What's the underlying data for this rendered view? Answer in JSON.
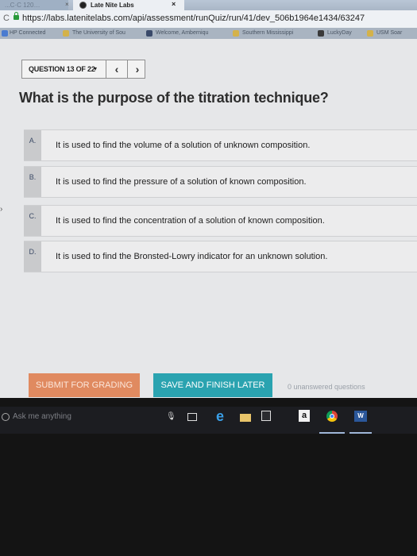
{
  "browser": {
    "tabs": [
      {
        "label": "...C·C 120…",
        "active": false
      },
      {
        "label": "Late Nite Labs",
        "active": true
      }
    ],
    "close_glyph": "×",
    "url": "https://labs.latenitelabs.com/api/assessment/runQuiz/run/41/dev_506b1964e1434/63247",
    "bookmarks": [
      {
        "label": "HP Connected",
        "icon": "hp-icon",
        "color": "#4a7bd0"
      },
      {
        "label": "The University of Sou",
        "icon": "university-icon",
        "color": "#d4b24a"
      },
      {
        "label": "Welcome, Amberniqu",
        "icon": "portal-icon",
        "color": "#3a4a6a"
      },
      {
        "label": "Southern Mississippi",
        "icon": "usm-icon",
        "color": "#d4b24a"
      },
      {
        "label": "LuckyDay",
        "icon": "luckyday-icon",
        "color": "#3a3a3a"
      },
      {
        "label": "USM Soar",
        "icon": "soar-icon",
        "color": "#d4b24a"
      }
    ]
  },
  "quiz": {
    "counter": "QUESTION 13 OF 22",
    "caret": "▾",
    "prev": "‹",
    "next": "›",
    "question": "What is the purpose of the titration technique?",
    "answers": [
      {
        "letter": "A.",
        "text": "It is used to find the volume of a solution of unknown composition."
      },
      {
        "letter": "B.",
        "text": "It is used to find the pressure of a solution of known composition."
      },
      {
        "letter": "C.",
        "text": "It is used to find the concentration of a solution of known composition."
      },
      {
        "letter": "D.",
        "text": "It is used to find the Bronsted-Lowry indicator for an unknown solution."
      }
    ],
    "submit_label": "SUBMIT FOR GRADING",
    "save_label": "SAVE AND FINISH LATER",
    "unanswered": "0 unanswered questions"
  },
  "taskbar": {
    "search_placeholder": "Ask me anything",
    "amazon_label": "a",
    "word_label": "W"
  },
  "colors": {
    "submit": "#e08a60",
    "save": "#2aa3b0",
    "page_bg": "#e6e7e9"
  }
}
